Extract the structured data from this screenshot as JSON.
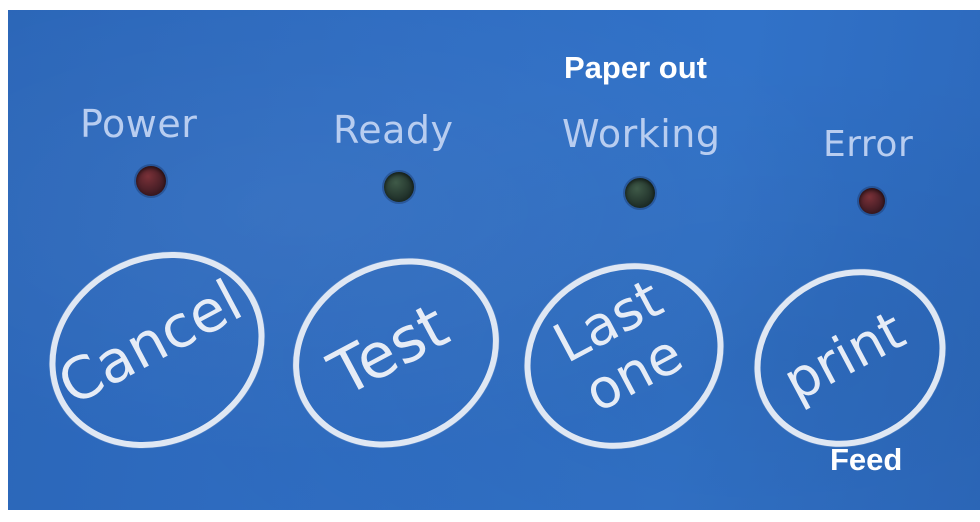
{
  "panel": {
    "top_label": "Paper out",
    "bottom_label": "Feed",
    "indicators": [
      {
        "label": "Power",
        "led_color": "#6b2a33"
      },
      {
        "label": "Ready",
        "led_color": "#34493d"
      },
      {
        "label": "Working",
        "led_color": "#34493d"
      },
      {
        "label": "Error",
        "led_color": "#6b2a33"
      }
    ],
    "buttons": [
      {
        "line1": "Cancel",
        "line2": ""
      },
      {
        "line1": "Test",
        "line2": ""
      },
      {
        "line1": "Last",
        "line2": "one"
      },
      {
        "line1": "print",
        "line2": ""
      }
    ]
  },
  "colors": {
    "panel_blue": "#2f6dc2",
    "label_blue": "#b8cdf0",
    "key_outline": "#dfe7f3"
  }
}
